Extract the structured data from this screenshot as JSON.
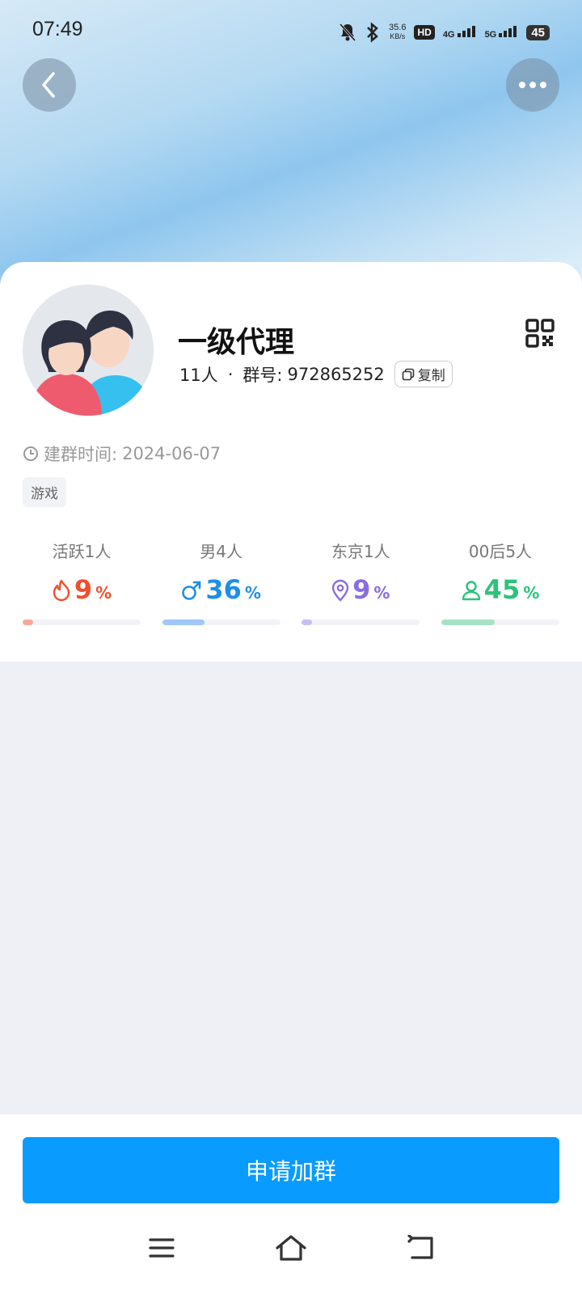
{
  "status_bar": {
    "time": "07:49",
    "speed_value": "35.6",
    "speed_unit": "KB/s",
    "hd_label": "HD",
    "net_4g": "4G",
    "net_5g": "5G",
    "battery": "45"
  },
  "group": {
    "name": "一级代理",
    "member_count": "11人",
    "separator": "·",
    "id_label": "群号:",
    "id": "972865252",
    "copy_label": "复制",
    "created_label": "建群时间:",
    "created_date": "2024-06-07",
    "tag": "游戏"
  },
  "stats": [
    {
      "label": "活跃1人",
      "value": "9",
      "unit": "%",
      "fraction": 0.09,
      "icon": "flame-icon",
      "color": "#f04f2e",
      "bar_color": "#f9a99a"
    },
    {
      "label": "男4人",
      "value": "36",
      "unit": "%",
      "fraction": 0.36,
      "icon": "male-icon",
      "color": "#1e8fe6",
      "bar_color": "#9fc7f8"
    },
    {
      "label": "东京1人",
      "value": "9",
      "unit": "%",
      "fraction": 0.09,
      "icon": "location-pin-icon",
      "color": "#8a6ee0",
      "bar_color": "#c9bdf2"
    },
    {
      "label": "00后5人",
      "value": "45",
      "unit": "%",
      "fraction": 0.45,
      "icon": "person-icon",
      "color": "#2cc37a",
      "bar_color": "#a6e3c4"
    }
  ],
  "actions": {
    "join_label": "申请加群"
  },
  "colors": {
    "primary": "#0a9bff",
    "page_background": "#eff0f5"
  }
}
